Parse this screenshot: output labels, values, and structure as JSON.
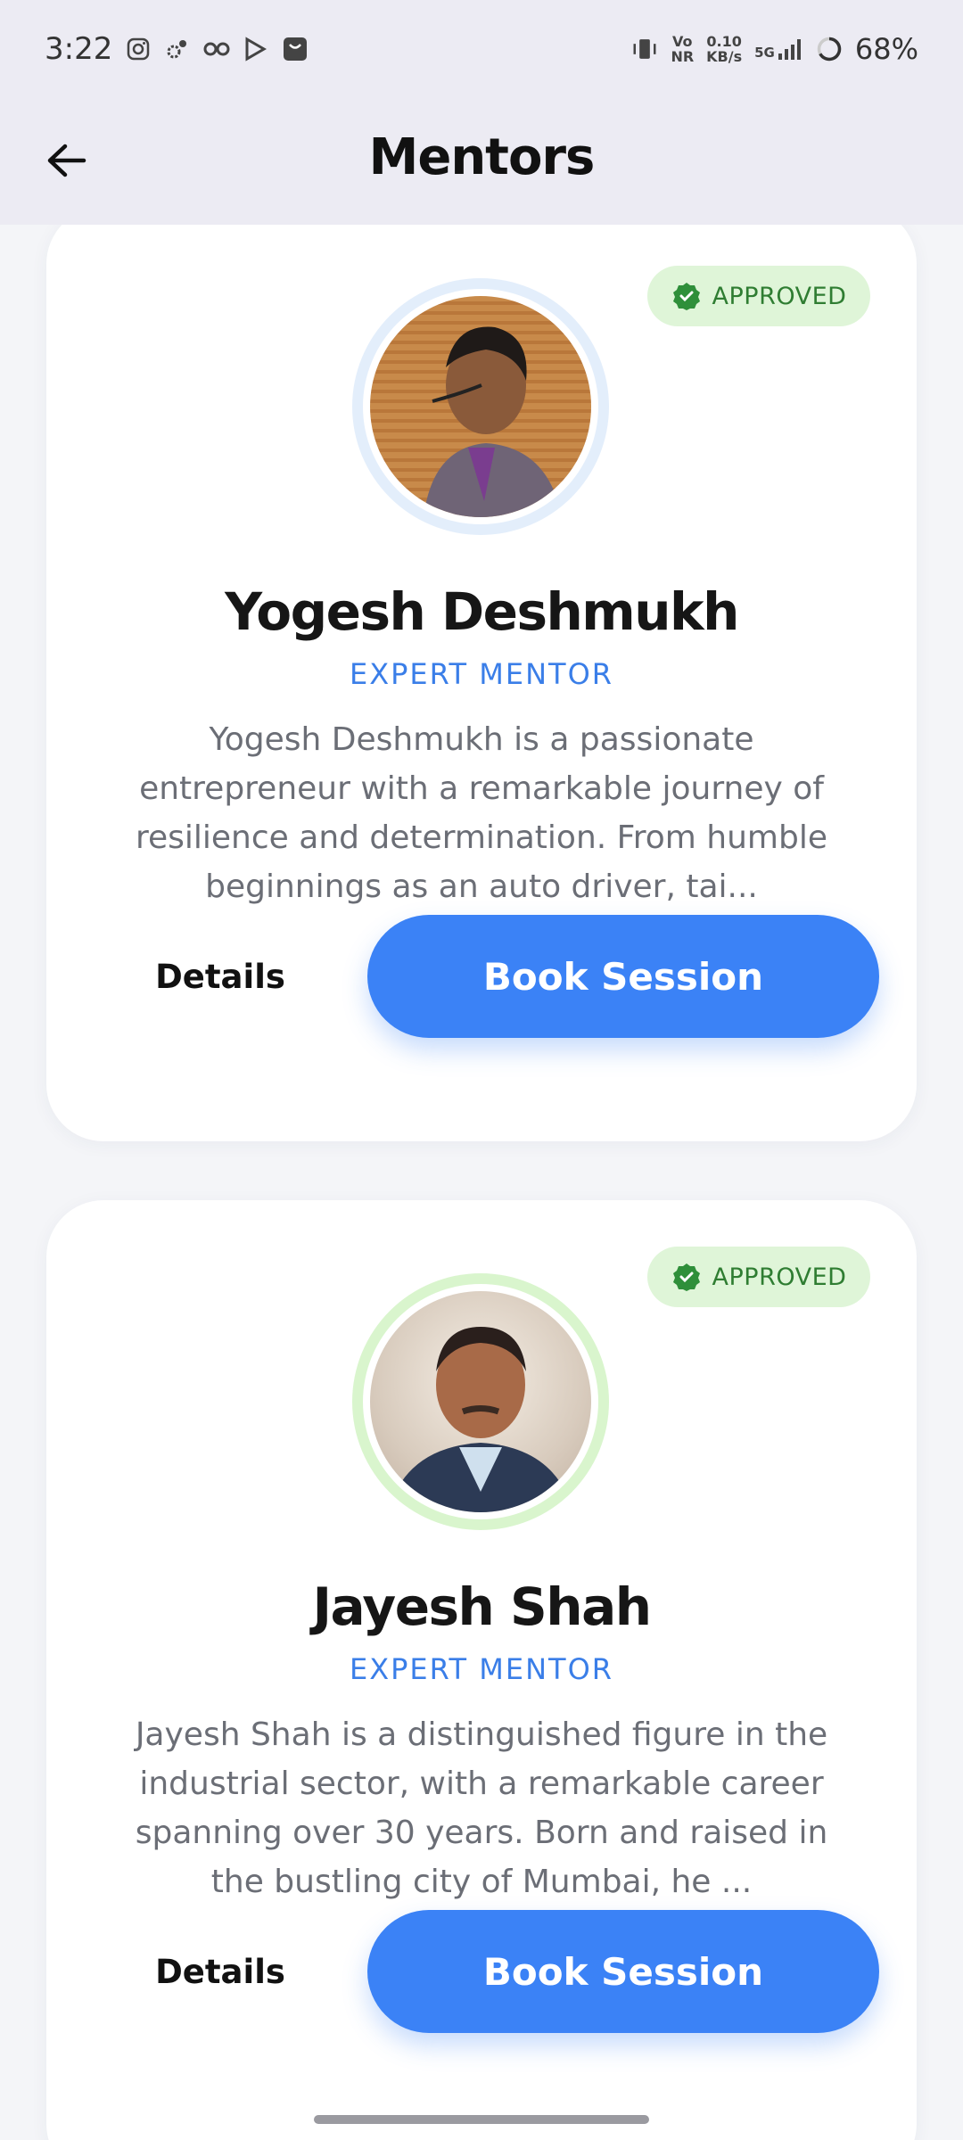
{
  "status_bar": {
    "time": "3:22",
    "net_top": "Vo",
    "net_bottom": "NR",
    "speed_top": "0.10",
    "speed_bottom": "KB/s",
    "signal": "5G",
    "battery": "68%"
  },
  "app_bar": {
    "title": "Mentors",
    "back_icon": "arrow-left-icon"
  },
  "mentors": [
    {
      "badge": "APPROVED",
      "name": "Yogesh Deshmukh",
      "role": "EXPERT MENTOR",
      "bio": "Yogesh Deshmukh is a passionate entrepreneur with a remarkable journey of resilience and determination. From humble beginnings as an auto driver, tai...",
      "details_label": "Details",
      "book_label": "Book Session",
      "ring_color": "#e3eefb"
    },
    {
      "badge": "APPROVED",
      "name": "Jayesh Shah",
      "role": "EXPERT MENTOR",
      "bio": "Jayesh Shah is a distinguished figure in the industrial sector, with a remarkable career spanning over 30 years. Born and raised in the bustling city of Mumbai, he ...",
      "details_label": "Details",
      "book_label": "Book Session",
      "ring_color": "#d9f5cd"
    }
  ],
  "colors": {
    "accent": "#3b82f6",
    "approved_bg": "#dff5d8",
    "approved_text": "#2f7d32",
    "role_text": "#3a7ee8"
  }
}
